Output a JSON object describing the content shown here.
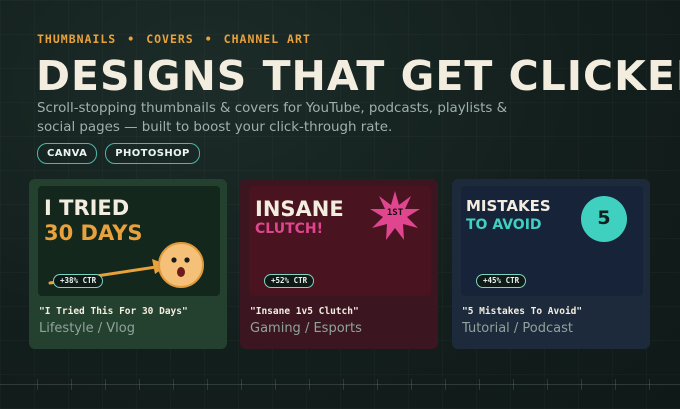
{
  "eyebrow": {
    "items": [
      "THUMBNAILS",
      "COVERS",
      "CHANNEL ART"
    ],
    "separator": "•"
  },
  "headline": "DESIGNS THAT GET CLICKED",
  "subtitle": "Scroll-stopping thumbnails & covers for YouTube, podcasts, playlists & social pages — built to boost your click-through rate.",
  "tags": [
    "CANVA",
    "PHOTOSHOP"
  ],
  "cards": [
    {
      "thumb": {
        "line1": "I TRIED",
        "line2": "30 DAYS",
        "ctr": "+38% CTR"
      },
      "title": "\"I Tried This For 30 Days\"",
      "category": "Lifestyle / Vlog"
    },
    {
      "thumb": {
        "line1": "INSANE",
        "line2": "CLUTCH!",
        "badge": "1ST",
        "ctr": "+52% CTR"
      },
      "title": "\"Insane 1v5 Clutch\"",
      "category": "Gaming / Esports"
    },
    {
      "thumb": {
        "line1": "MISTAKES",
        "line2": "TO AVOID",
        "badge": "5",
        "ctr": "+45% CTR"
      },
      "title": "\"5 Mistakes To Avoid\"",
      "category": "Tutorial / Podcast"
    }
  ],
  "colors": {
    "accent_orange": "#e9a23b",
    "teal": "#3fd0c0",
    "pink": "#e0468f",
    "cream": "#f3ede0"
  }
}
